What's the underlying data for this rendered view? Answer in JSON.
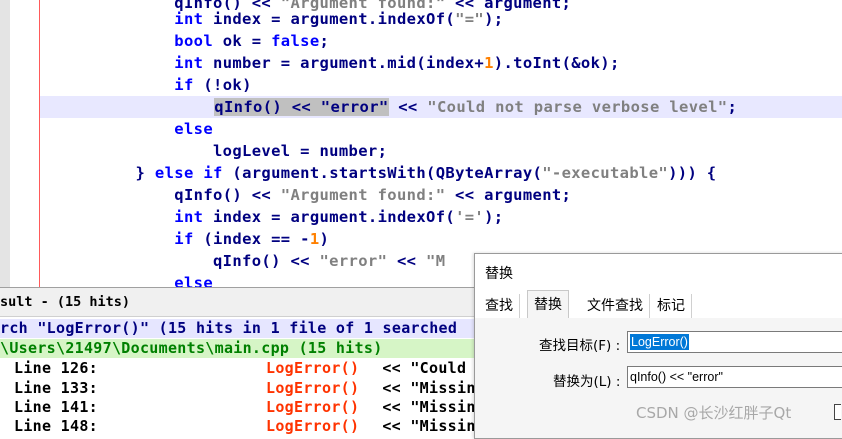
{
  "editor": {
    "lines": [
      {
        "indent": "                  ",
        "parts": [
          [
            "op",
            "qInfo() << "
          ],
          [
            "str",
            "\"Argument found:\""
          ],
          [
            "op",
            " << argument;"
          ]
        ]
      },
      {
        "indent": "                  ",
        "parts": [
          [
            "kw",
            "int"
          ],
          [
            "op",
            " index = argument.indexOf("
          ],
          [
            "str",
            "\"=\""
          ],
          [
            "op",
            ");"
          ]
        ]
      },
      {
        "indent": "                  ",
        "parts": [
          [
            "kw",
            "bool"
          ],
          [
            "op",
            " ok = "
          ],
          [
            "kw",
            "false"
          ],
          [
            "op",
            ";"
          ]
        ]
      },
      {
        "indent": "                  ",
        "parts": [
          [
            "kw",
            "int"
          ],
          [
            "op",
            " number = argument.mid(index+"
          ],
          [
            "num",
            "1"
          ],
          [
            "op",
            ").toInt(&ok);"
          ]
        ]
      },
      {
        "indent": "                  ",
        "parts": [
          [
            "kw",
            "if"
          ],
          [
            "op",
            " (!ok)"
          ]
        ]
      },
      {
        "indent": "                      ",
        "parts": [
          [
            "sel",
            "qInfo() << \"error\""
          ],
          [
            "op",
            " << "
          ],
          [
            "str",
            "\"Could not parse verbose level\""
          ],
          [
            "op",
            ";"
          ]
        ]
      },
      {
        "indent": "                  ",
        "parts": [
          [
            "kw",
            "else"
          ]
        ]
      },
      {
        "indent": "                      ",
        "parts": [
          [
            "op",
            "logLevel = number;"
          ]
        ]
      },
      {
        "indent": "              ",
        "parts": [
          [
            "op",
            "} "
          ],
          [
            "kw",
            "else if"
          ],
          [
            "op",
            " (argument.startsWith(QByteArray("
          ],
          [
            "str",
            "\"-executable\""
          ],
          [
            "op",
            "))) {"
          ]
        ]
      },
      {
        "indent": "                  ",
        "parts": [
          [
            "op",
            "qInfo() << "
          ],
          [
            "str",
            "\"Argument found:\""
          ],
          [
            "op",
            " << argument;"
          ]
        ]
      },
      {
        "indent": "                  ",
        "parts": [
          [
            "kw",
            "int"
          ],
          [
            "op",
            " index = argument.indexOf("
          ],
          [
            "str",
            "'='"
          ],
          [
            "op",
            ");"
          ]
        ]
      },
      {
        "indent": "                  ",
        "parts": [
          [
            "kw",
            "if"
          ],
          [
            "op",
            " (index == -"
          ],
          [
            "num",
            "1"
          ],
          [
            "op",
            ")"
          ]
        ]
      },
      {
        "indent": "                      ",
        "parts": [
          [
            "op",
            "qInfo() << "
          ],
          [
            "str",
            "\"error\""
          ],
          [
            "op",
            " << "
          ],
          [
            "str",
            "\"M"
          ]
        ]
      },
      {
        "indent": "                  ",
        "parts": [
          [
            "kw",
            "else"
          ]
        ]
      }
    ]
  },
  "results": {
    "tab_label": "sult - (15 hits)",
    "search_line": "rch \"LogError()\" (15 hits in 1 file of 1 searched",
    "file_line": "\\Users\\21497\\Documents\\main.cpp (15 hits)",
    "rows": [
      {
        "line": "Line 126:",
        "hit": "LogError()",
        "rest_op": " << ",
        "rest_str": "\"Could n"
      },
      {
        "line": "Line 133:",
        "hit": "LogError()",
        "rest_op": " << ",
        "rest_str": "\"Missing"
      },
      {
        "line": "Line 141:",
        "hit": "LogError()",
        "rest_op": " << ",
        "rest_str": "\"Missing"
      },
      {
        "line": "Line 148:",
        "hit": "LogError()",
        "rest_op": " << ",
        "rest_str": "\"Missing"
      }
    ]
  },
  "dialog": {
    "title": "替换",
    "tabs": [
      "查找",
      "替换",
      "文件查找",
      "标记"
    ],
    "active_tab": "替换",
    "find_label": "查找目标(F) :",
    "find_value": "LogError()",
    "replace_label": "替换为(L) :",
    "replace_value": "qInfo() << \"error\""
  },
  "watermark": "CSDN @长沙红胖子Qt"
}
